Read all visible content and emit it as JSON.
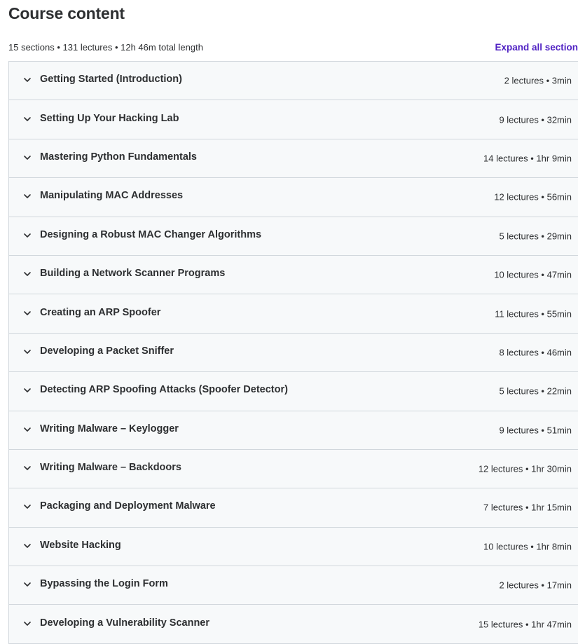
{
  "header": {
    "title": "Course content",
    "summary": "15 sections • 131 lectures • 12h 46m total length",
    "expand_label": "Expand all section"
  },
  "colors": {
    "accent": "#5022c3",
    "row_background": "#f7f9fa",
    "border": "#d1d7dc",
    "text": "#2d2f31"
  },
  "icons": {
    "section_toggle": "chevron-down-icon"
  },
  "sections": [
    {
      "title": "Getting Started (Introduction)",
      "info": "2 lectures • 3min"
    },
    {
      "title": "Setting Up Your Hacking Lab",
      "info": "9 lectures • 32min"
    },
    {
      "title": "Mastering Python Fundamentals",
      "info": "14 lectures • 1hr 9min"
    },
    {
      "title": "Manipulating MAC Addresses",
      "info": "12 lectures • 56min"
    },
    {
      "title": "Designing a Robust MAC Changer Algorithms",
      "info": "5 lectures • 29min"
    },
    {
      "title": "Building a Network Scanner Programs",
      "info": "10 lectures • 47min"
    },
    {
      "title": "Creating an ARP Spoofer",
      "info": "11 lectures • 55min"
    },
    {
      "title": "Developing a Packet Sniffer",
      "info": "8 lectures • 46min"
    },
    {
      "title": "Detecting ARP Spoofing Attacks (Spoofer Detector)",
      "info": "5 lectures • 22min"
    },
    {
      "title": "Writing Malware – Keylogger",
      "info": "9 lectures • 51min"
    },
    {
      "title": "Writing Malware – Backdoors",
      "info": "12 lectures • 1hr 30min"
    },
    {
      "title": "Packaging and Deployment Malware",
      "info": "7 lectures • 1hr 15min"
    },
    {
      "title": "Website Hacking",
      "info": "10 lectures • 1hr 8min"
    },
    {
      "title": "Bypassing the Login Form",
      "info": "2 lectures • 17min"
    },
    {
      "title": "Developing a Vulnerability Scanner",
      "info": "15 lectures • 1hr 47min"
    }
  ]
}
